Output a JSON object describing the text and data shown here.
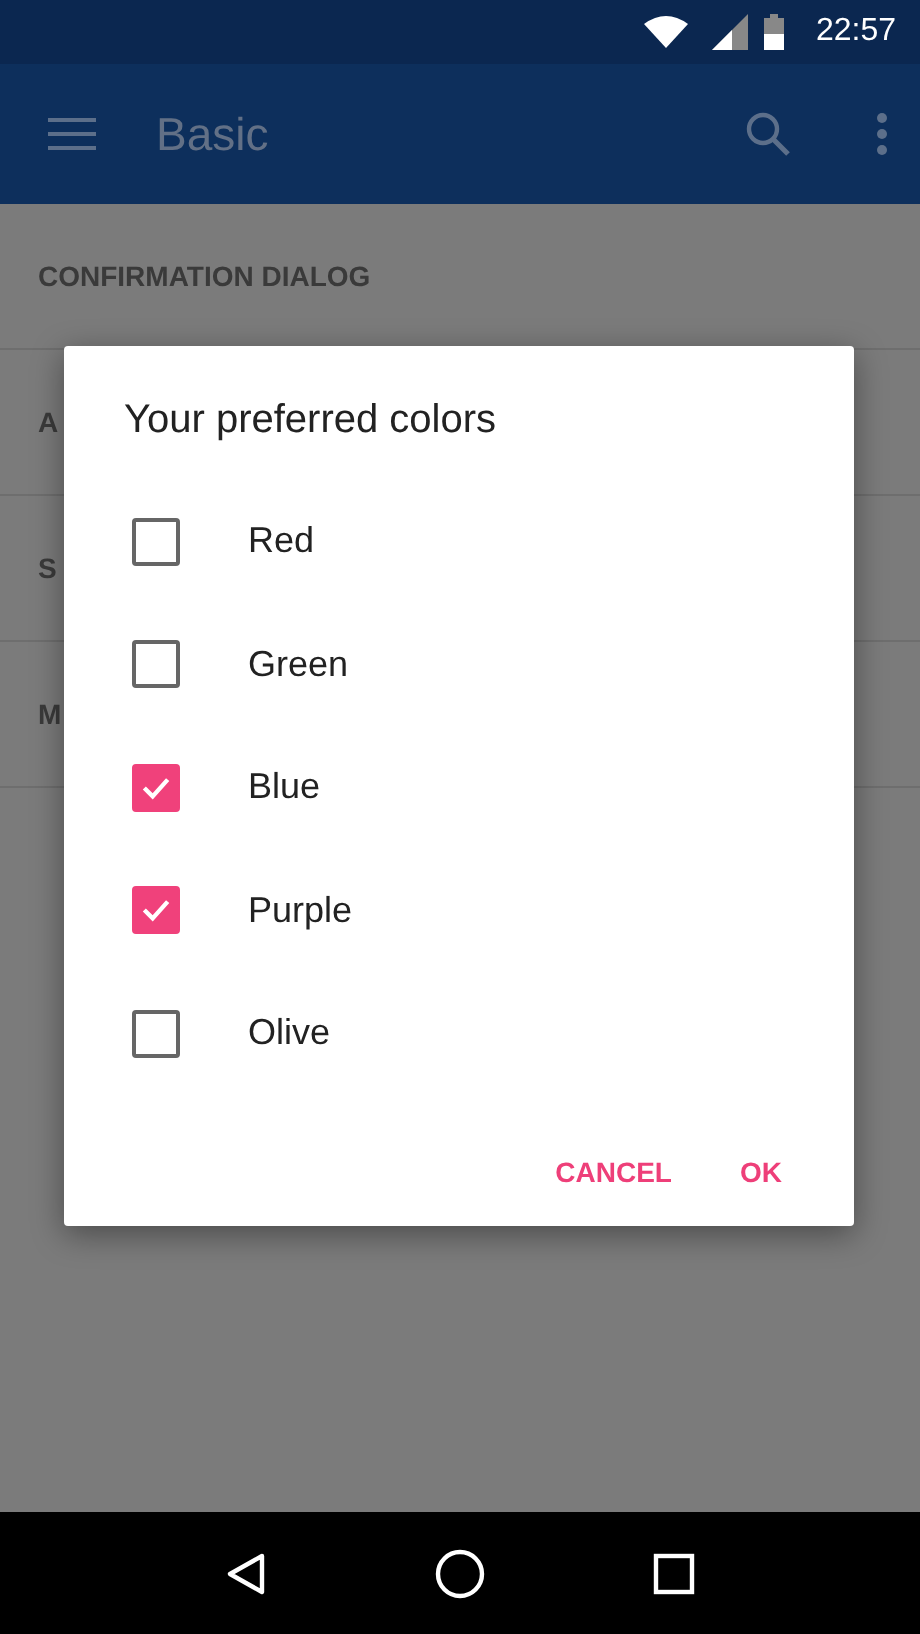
{
  "status_bar": {
    "time": "22:57"
  },
  "app_bar": {
    "title": "Basic"
  },
  "list_items": [
    {
      "label": "CONFIRMATION DIALOG"
    },
    {
      "label": "A"
    },
    {
      "label": "S"
    },
    {
      "label": "M"
    }
  ],
  "dialog": {
    "title": "Your preferred colors",
    "options": [
      {
        "label": "Red",
        "checked": false
      },
      {
        "label": "Green",
        "checked": false
      },
      {
        "label": "Blue",
        "checked": true
      },
      {
        "label": "Purple",
        "checked": true
      },
      {
        "label": "Olive",
        "checked": false
      }
    ],
    "buttons": [
      "CANCEL",
      "OK"
    ]
  }
}
